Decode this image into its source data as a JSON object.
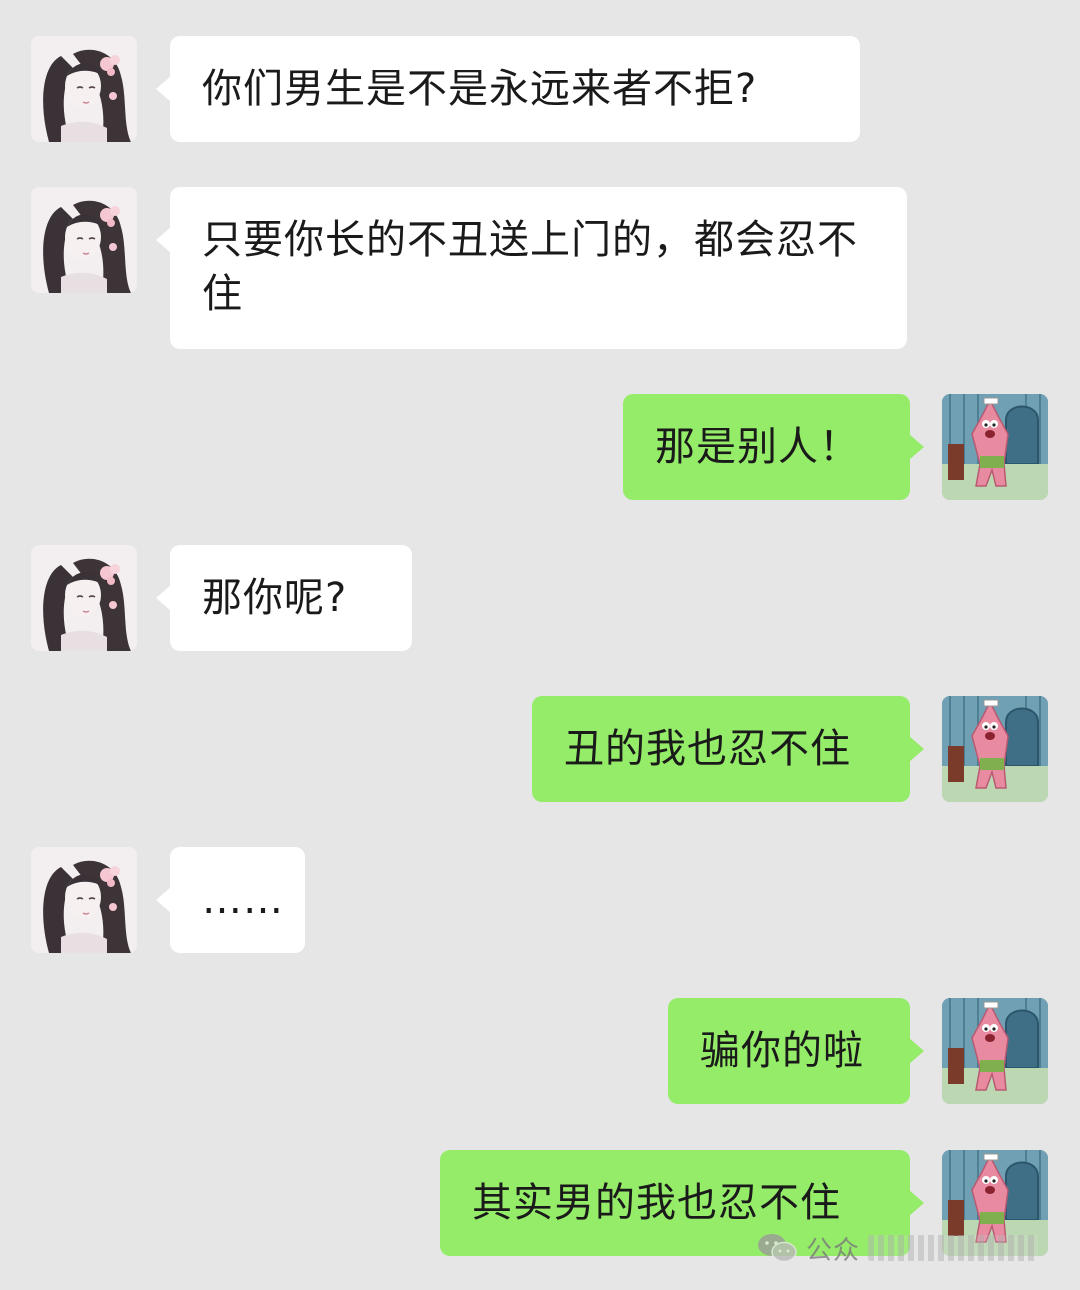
{
  "chat": {
    "messages": [
      {
        "side": "in",
        "text": "你们男生是不是永远来者不拒?"
      },
      {
        "side": "in",
        "text": "只要你长的不丑送上门的，都会忍不住"
      },
      {
        "side": "out",
        "text": "那是别人！"
      },
      {
        "side": "in",
        "text": "那你呢?"
      },
      {
        "side": "out",
        "text": "丑的我也忍不住"
      },
      {
        "side": "in",
        "text": "……"
      },
      {
        "side": "out",
        "text": "骗你的啦"
      },
      {
        "side": "out",
        "text": "其实男的我也忍不住"
      }
    ]
  },
  "watermark": {
    "icon": "wechat-icon",
    "text": "公众"
  },
  "colors": {
    "background": "#e6e6e6",
    "incoming_bubble": "#ffffff",
    "outgoing_bubble": "#95ec69",
    "text": "#1a1a1a"
  }
}
